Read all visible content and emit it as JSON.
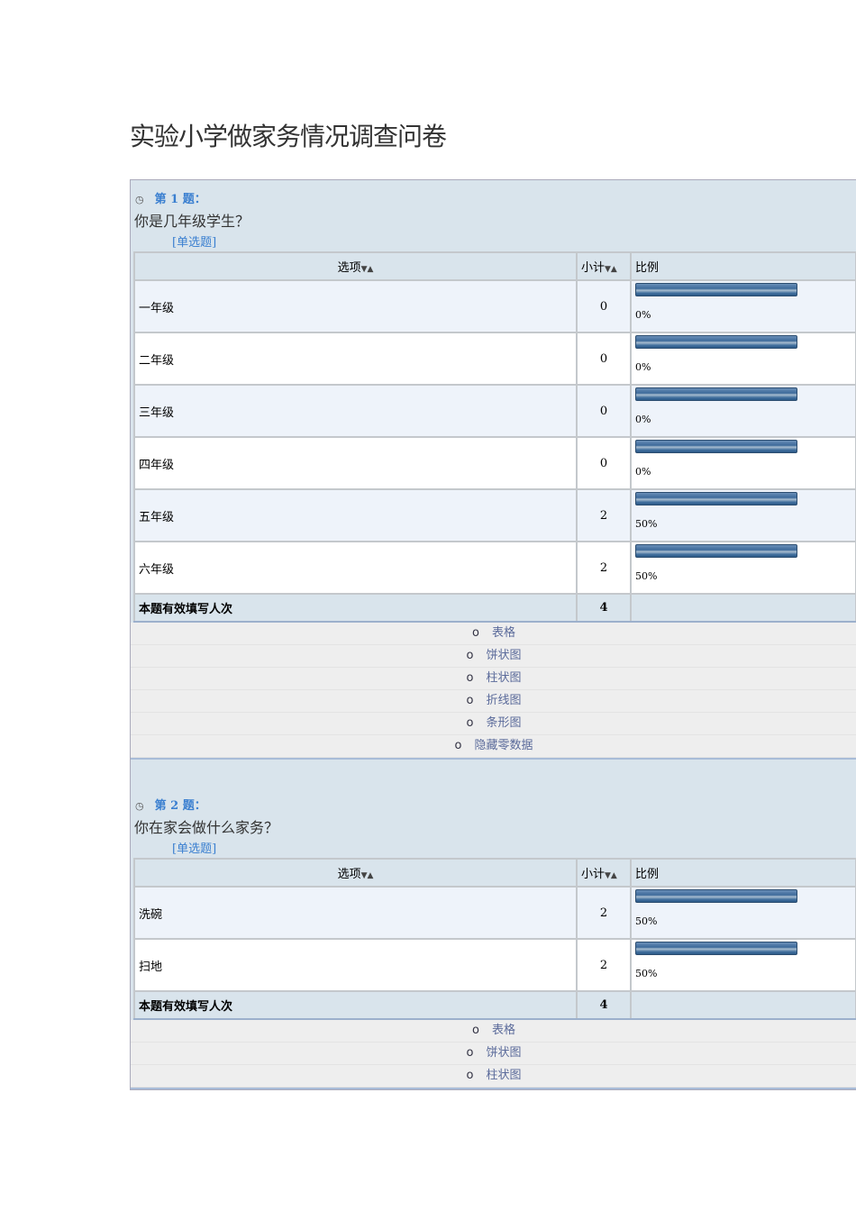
{
  "title": "实验小学做家务情况调查问卷",
  "headers": {
    "option": "选项",
    "count": "小计",
    "ratio": "比例",
    "sort": "▼▲"
  },
  "questions": [
    {
      "num": "第 1 题：",
      "text": "你是几年级学生？",
      "type": "[单选题]",
      "rows": [
        {
          "label": "一年级",
          "count": "0",
          "pct": "0%"
        },
        {
          "label": "二年级",
          "count": "0",
          "pct": "0%"
        },
        {
          "label": "三年级",
          "count": "0",
          "pct": "0%"
        },
        {
          "label": "四年级",
          "count": "0",
          "pct": "0%"
        },
        {
          "label": "五年级",
          "count": "2",
          "pct": "50%"
        },
        {
          "label": "六年级",
          "count": "2",
          "pct": "50%"
        }
      ],
      "total_label": "本题有效填写人次",
      "total": "4",
      "links": [
        "表格",
        "饼状图",
        "柱状图",
        "折线图",
        "条形图",
        "隐藏零数据"
      ]
    },
    {
      "num": "第 2 题：",
      "text": "你在家会做什么家务？",
      "type": "[单选题]",
      "rows": [
        {
          "label": "洗碗",
          "count": "2",
          "pct": "50%"
        },
        {
          "label": "扫地",
          "count": "2",
          "pct": "50%"
        }
      ],
      "total_label": "本题有效填写人次",
      "total": "4",
      "links": [
        "表格",
        "饼状图",
        "柱状图"
      ]
    }
  ],
  "bullet": "o",
  "clock_icon": "◷"
}
